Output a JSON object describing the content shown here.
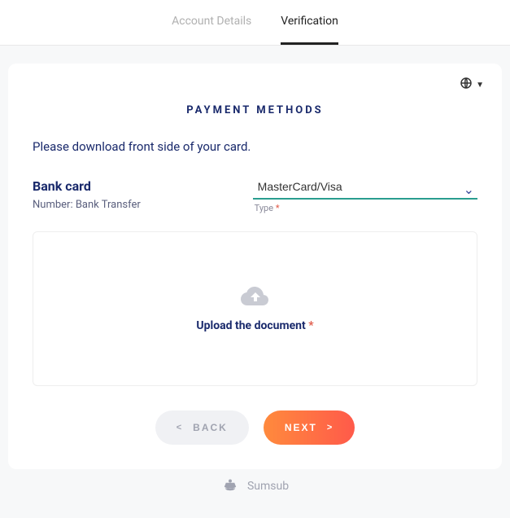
{
  "tabs": {
    "account_details": "Account Details",
    "verification": "Verification"
  },
  "section_title": "PAYMENT METHODS",
  "instruction": "Please download front side of your card.",
  "bank": {
    "title": "Bank card",
    "number_label": "Number: Bank Transfer"
  },
  "type_field": {
    "value": "MasterCard/Visa",
    "label": "Type",
    "required_mark": "*"
  },
  "upload": {
    "text": "Upload the document",
    "required_mark": "*"
  },
  "buttons": {
    "back_chevron": "<",
    "back": "BACK",
    "next": "NEXT",
    "next_chevron": ">"
  },
  "footer": {
    "brand": "Sumsub"
  }
}
